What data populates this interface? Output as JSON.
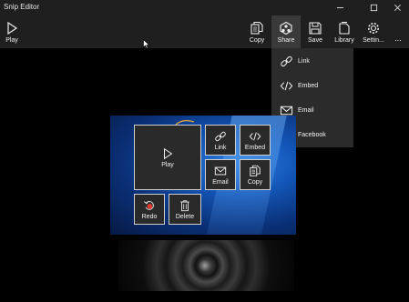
{
  "window": {
    "title": "Snip Editor"
  },
  "toolbar": {
    "play": "Play",
    "copy": "Copy",
    "share": "Share",
    "save": "Save",
    "library": "Library",
    "settings": "Settin...",
    "more": "..."
  },
  "share_menu": {
    "items": [
      {
        "label": "Link",
        "icon": "link-icon"
      },
      {
        "label": "Embed",
        "icon": "embed-icon"
      },
      {
        "label": "Email",
        "icon": "email-icon"
      },
      {
        "label": "Facebook",
        "icon": "facebook-icon"
      }
    ]
  },
  "overlay": {
    "play": "Play",
    "link": "Link",
    "embed": "Embed",
    "email": "Email",
    "copy": "Copy",
    "redo": "Redo",
    "delete": "Delete"
  },
  "colors": {
    "toolbar_bg": "#1f1f1f",
    "menu_bg": "#2b2b2b",
    "tile_bg": "#2a2a2a",
    "redo_red": "#e0382b",
    "facebook_blue": "#3b5998"
  }
}
